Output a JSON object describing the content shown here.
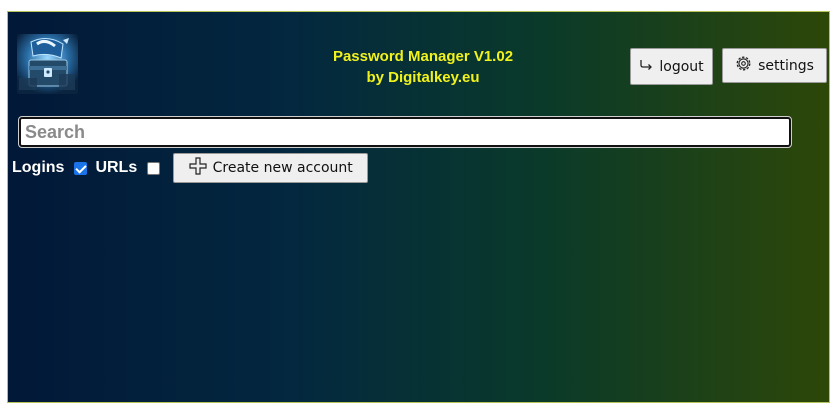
{
  "header": {
    "title_line1": "Password Manager V1.02",
    "title_line2": "by Digitalkey.eu",
    "logo_icon": "treasure-chest-logo-icon"
  },
  "toolbar": {
    "logout_label": "logout",
    "logout_icon": "arrow-return-icon",
    "settings_label": "settings",
    "settings_icon": "gear-icon"
  },
  "search": {
    "placeholder": "Search",
    "value": ""
  },
  "filters": {
    "logins_label": "Logins",
    "logins_checked": true,
    "urls_label": "URLs",
    "urls_checked": false
  },
  "actions": {
    "create_label": "Create new account",
    "create_icon": "plus-icon"
  },
  "colors": {
    "title": "#f2f21c",
    "bg_left": "#021838",
    "bg_right": "#2d4708",
    "checkbox_accent": "#1a73e8"
  }
}
